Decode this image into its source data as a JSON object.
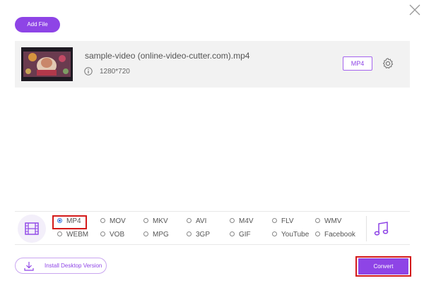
{
  "toolbar": {
    "add_file_label": "Add File"
  },
  "file": {
    "name": "sample-video (online-video-cutter.com).mp4",
    "resolution": "1280*720",
    "format_badge": "MP4"
  },
  "formats": {
    "selected": "MP4",
    "row1": [
      "MP4",
      "MOV",
      "MKV",
      "AVI",
      "M4V",
      "FLV",
      "WMV"
    ],
    "row2": [
      "WEBM",
      "VOB",
      "MPG",
      "3GP",
      "GIF",
      "YouTube",
      "Facebook"
    ]
  },
  "footer": {
    "install_label": "Install Desktop Version",
    "convert_label": "Convert"
  },
  "colors": {
    "accent": "#8e44e6",
    "highlight": "#d41a1a",
    "radio_selected": "#3a7be0"
  },
  "icons": [
    "close-icon",
    "info-icon",
    "gear-icon",
    "film-icon",
    "music-note-icon",
    "download-icon"
  ]
}
